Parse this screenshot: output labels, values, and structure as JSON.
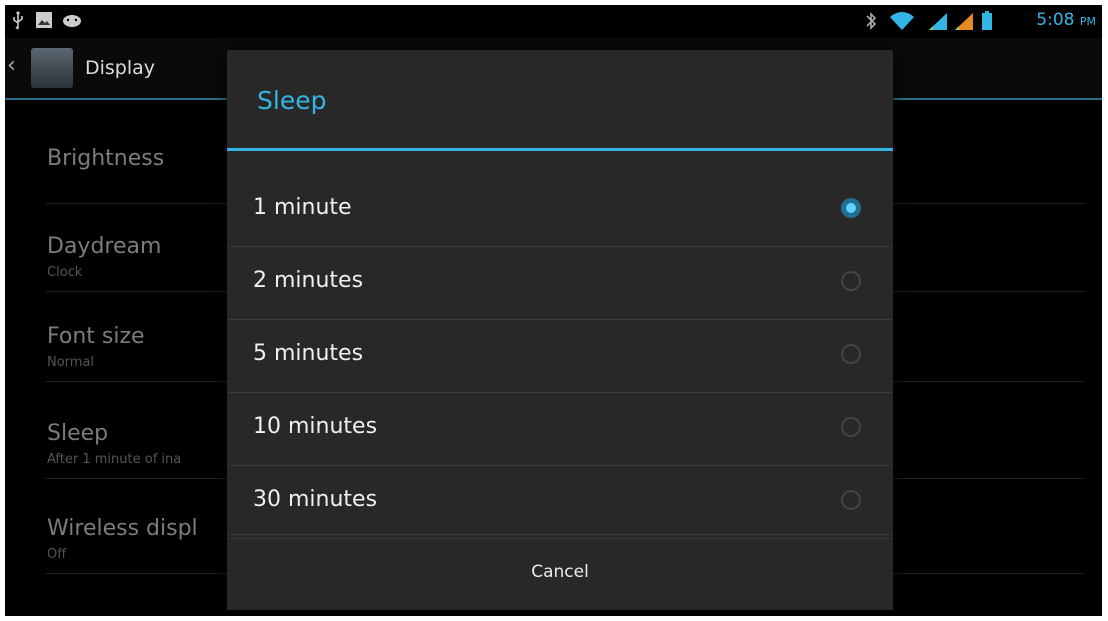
{
  "status_bar": {
    "time": "5:08",
    "ampm": "PM",
    "left_icons": [
      "usb-icon",
      "image-icon",
      "android-debug-icon"
    ],
    "right_icons": [
      "bluetooth-icon",
      "wifi-icon",
      "signal-icon",
      "signal-icon",
      "battery-icon"
    ],
    "accent": "#33b5e5"
  },
  "action_bar": {
    "title": "Display"
  },
  "settings": [
    {
      "title": "Brightness",
      "sub": ""
    },
    {
      "title": "Daydream",
      "sub": "Clock"
    },
    {
      "title": "Font size",
      "sub": "Normal"
    },
    {
      "title": "Sleep",
      "sub": "After 1 minute of ina"
    },
    {
      "title": "Wireless displ",
      "sub": "Off"
    }
  ],
  "dialog": {
    "title": "Sleep",
    "options": [
      {
        "label": "1 minute",
        "selected": true
      },
      {
        "label": "2 minutes",
        "selected": false
      },
      {
        "label": "5 minutes",
        "selected": false
      },
      {
        "label": "10 minutes",
        "selected": false
      },
      {
        "label": "30 minutes",
        "selected": false
      }
    ],
    "cancel_label": "Cancel"
  }
}
